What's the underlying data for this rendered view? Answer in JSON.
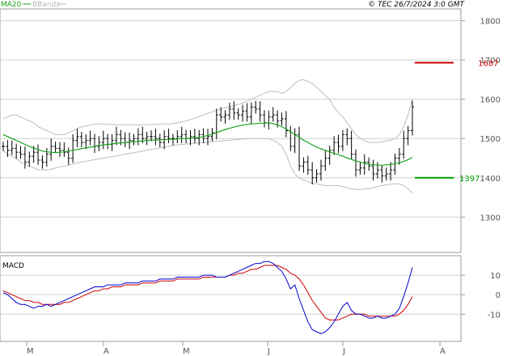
{
  "header": {
    "legend_ma": "MA20",
    "legend_bands": "BBands",
    "copyright": "© TEC 26/7/2024 3:0 GMT",
    "ma_color": "#1aa31a",
    "bands_color": "#bdbdbd"
  },
  "chart_data": [
    {
      "type": "candlestick-with-overlays",
      "yticks": [
        1300,
        1400,
        1500,
        1600,
        1700,
        1800
      ],
      "ylim": [
        1210,
        1830
      ],
      "grid": true,
      "x_ticks": [
        "M",
        "A",
        "M",
        "J",
        "J",
        "A"
      ],
      "resistance": {
        "label": "1687",
        "value": 1693,
        "color": "#cc0000"
      },
      "support": {
        "label": "1397",
        "value": 1400,
        "color": "#009900"
      },
      "close": [
        1480,
        1470,
        1475,
        1465,
        1460,
        1440,
        1455,
        1465,
        1445,
        1440,
        1460,
        1480,
        1475,
        1470,
        1465,
        1450,
        1495,
        1505,
        1490,
        1495,
        1500,
        1480,
        1490,
        1500,
        1485,
        1495,
        1510,
        1500,
        1490,
        1495,
        1500,
        1510,
        1500,
        1505,
        1505,
        1500,
        1490,
        1505,
        1500,
        1500,
        1505,
        1510,
        1500,
        1505,
        1500,
        1510,
        1500,
        1505,
        1515,
        1560,
        1555,
        1560,
        1575,
        1565,
        1560,
        1570,
        1555,
        1580,
        1575,
        1560,
        1540,
        1555,
        1560,
        1545,
        1550,
        1520,
        1480,
        1510,
        1430,
        1440,
        1420,
        1400,
        1410,
        1430,
        1450,
        1470,
        1490,
        1480,
        1510,
        1500,
        1460,
        1420,
        1425,
        1440,
        1430,
        1410,
        1420,
        1405,
        1410,
        1420,
        1450,
        1460,
        1500,
        1520,
        1580
      ],
      "ma20": [
        1510,
        1505,
        1500,
        1495,
        1490,
        1485,
        1480,
        1476,
        1472,
        1468,
        1466,
        1465,
        1464,
        1465,
        1466,
        1468,
        1470,
        1472,
        1474,
        1476,
        1478,
        1480,
        1482,
        1484,
        1485,
        1486,
        1488,
        1489,
        1490,
        1491,
        1492,
        1493,
        1494,
        1495,
        1496,
        1496,
        1497,
        1497,
        1498,
        1498,
        1499,
        1500,
        1500,
        1501,
        1502,
        1503,
        1505,
        1508,
        1511,
        1515,
        1519,
        1523,
        1526,
        1529,
        1532,
        1534,
        1536,
        1537,
        1538,
        1539,
        1539,
        1540,
        1538,
        1535,
        1530,
        1524,
        1518,
        1510,
        1503,
        1496,
        1490,
        1484,
        1478,
        1474,
        1470,
        1466,
        1462,
        1459,
        1455,
        1451,
        1447,
        1443,
        1440,
        1437,
        1435,
        1433,
        1432,
        1432,
        1433,
        1434,
        1436,
        1438,
        1442,
        1446,
        1452
      ],
      "bb_upper": [
        1550,
        1555,
        1560,
        1560,
        1555,
        1550,
        1545,
        1540,
        1530,
        1525,
        1520,
        1515,
        1510,
        1510,
        1510,
        1515,
        1520,
        1525,
        1530,
        1532,
        1535,
        1536,
        1537,
        1537,
        1537,
        1536,
        1535,
        1535,
        1535,
        1535,
        1535,
        1535,
        1535,
        1535,
        1536,
        1536,
        1537,
        1537,
        1537,
        1538,
        1540,
        1542,
        1545,
        1548,
        1552,
        1556,
        1560,
        1564,
        1568,
        1572,
        1575,
        1578,
        1580,
        1584,
        1587,
        1590,
        1595,
        1600,
        1605,
        1610,
        1615,
        1620,
        1620,
        1620,
        1615,
        1620,
        1630,
        1640,
        1648,
        1650,
        1645,
        1640,
        1630,
        1620,
        1610,
        1600,
        1580,
        1565,
        1555,
        1540,
        1525,
        1510,
        1500,
        1495,
        1490,
        1490,
        1490,
        1492,
        1494,
        1496,
        1500,
        1510,
        1530,
        1560,
        1600
      ],
      "bb_lower": [
        1470,
        1460,
        1455,
        1450,
        1440,
        1435,
        1430,
        1425,
        1420,
        1420,
        1420,
        1422,
        1425,
        1428,
        1430,
        1432,
        1435,
        1438,
        1440,
        1442,
        1444,
        1446,
        1448,
        1450,
        1452,
        1454,
        1456,
        1458,
        1460,
        1462,
        1464,
        1466,
        1468,
        1470,
        1472,
        1474,
        1476,
        1478,
        1480,
        1482,
        1484,
        1485,
        1486,
        1487,
        1488,
        1489,
        1490,
        1491,
        1492,
        1493,
        1494,
        1495,
        1496,
        1497,
        1498,
        1499,
        1500,
        1500,
        1500,
        1500,
        1500,
        1500,
        1495,
        1490,
        1480,
        1460,
        1430,
        1410,
        1400,
        1395,
        1390,
        1385,
        1385,
        1382,
        1380,
        1380,
        1380,
        1380,
        1378,
        1375,
        1372,
        1370,
        1370,
        1372,
        1372,
        1375,
        1378,
        1380,
        1382,
        1384,
        1385,
        1384,
        1380,
        1372,
        1360
      ]
    },
    {
      "type": "macd",
      "title": "MACD",
      "yticks_labels": [
        "10",
        "0",
        "-10"
      ],
      "yticks": [
        10,
        0,
        -10
      ],
      "ylim": [
        -24,
        20
      ],
      "macd_color": "#0000cc",
      "signal_color": "#cc0000",
      "macd": [
        1,
        0,
        -2,
        -4,
        -5,
        -5,
        -6,
        -7,
        -6,
        -6,
        -5,
        -6,
        -5,
        -4,
        -3,
        -2,
        -1,
        0,
        1,
        2,
        3,
        4,
        4,
        4,
        5,
        5,
        5,
        5,
        6,
        6,
        6,
        6,
        7,
        7,
        7,
        7,
        8,
        8,
        8,
        8,
        9,
        9,
        9,
        9,
        9,
        9,
        10,
        10,
        10,
        9,
        9,
        9,
        10,
        11,
        12,
        13,
        14,
        15,
        16,
        16,
        17,
        17,
        16,
        14,
        12,
        8,
        3,
        5,
        -2,
        -8,
        -14,
        -18,
        -19,
        -20,
        -19,
        -17,
        -14,
        -10,
        -6,
        -4,
        -8,
        -10,
        -10,
        -11,
        -12,
        -12,
        -11,
        -12,
        -12,
        -11,
        -10,
        -7,
        -1,
        6,
        14
      ],
      "signal": [
        2,
        1,
        0,
        -1,
        -2,
        -3,
        -3,
        -4,
        -4,
        -5,
        -5,
        -5,
        -5,
        -5,
        -4,
        -4,
        -3,
        -2,
        -1,
        0,
        1,
        2,
        2,
        3,
        3,
        4,
        4,
        4,
        5,
        5,
        5,
        5,
        6,
        6,
        6,
        6,
        7,
        7,
        7,
        7,
        8,
        8,
        8,
        8,
        8,
        8,
        9,
        9,
        9,
        9,
        9,
        9,
        10,
        10,
        11,
        11,
        12,
        13,
        13,
        14,
        15,
        15,
        15,
        15,
        14,
        13,
        11,
        10,
        8,
        5,
        1,
        -3,
        -6,
        -9,
        -12,
        -13,
        -13,
        -13,
        -12,
        -11,
        -10,
        -10,
        -10,
        -10,
        -11,
        -11,
        -11,
        -11,
        -11,
        -11,
        -11,
        -10,
        -8,
        -5,
        -1
      ]
    }
  ]
}
